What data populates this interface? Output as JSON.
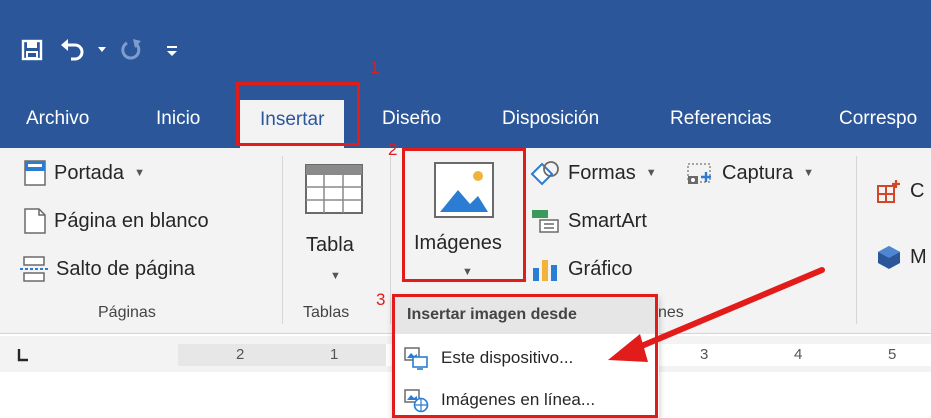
{
  "qat": {
    "save_icon": "save-icon",
    "undo_icon": "undo-icon",
    "redo_icon": "redo-icon",
    "customize_icon": "customize-qat-icon"
  },
  "tabs": [
    {
      "label": "Archivo"
    },
    {
      "label": "Inicio"
    },
    {
      "label": "Insertar",
      "active": true
    },
    {
      "label": "Diseño"
    },
    {
      "label": "Disposición"
    },
    {
      "label": "Referencias"
    },
    {
      "label": "Correspo"
    }
  ],
  "ribbon": {
    "paginas": {
      "portada": "Portada",
      "pagina_en_blanco": "Página en blanco",
      "salto_de_pagina": "Salto de página",
      "label": "Páginas"
    },
    "tablas": {
      "tabla": "Tabla",
      "label": "Tablas"
    },
    "ilustraciones": {
      "imagenes": "Imágenes",
      "formas": "Formas",
      "smartart": "SmartArt",
      "grafico": "Gráfico",
      "captura": "Captura",
      "label_fragment": "nes"
    },
    "right_partial": {
      "item1": "C",
      "item2": "M"
    }
  },
  "ruler": {
    "left_marks": [
      "2",
      "1"
    ],
    "right_marks": [
      "3",
      "4",
      "5"
    ]
  },
  "dropdown": {
    "header": "Insertar imagen desde",
    "items": [
      {
        "label": "Este dispositivo...",
        "icon": "device-image-icon"
      },
      {
        "label": "Imágenes en línea...",
        "icon": "online-image-icon"
      }
    ]
  },
  "annotations": {
    "step1": "1",
    "step2": "2",
    "step3": "3",
    "color": "#e21b1b"
  },
  "colors": {
    "title_bar": "#2b579a",
    "ribbon_bg": "#f3f3f3"
  }
}
